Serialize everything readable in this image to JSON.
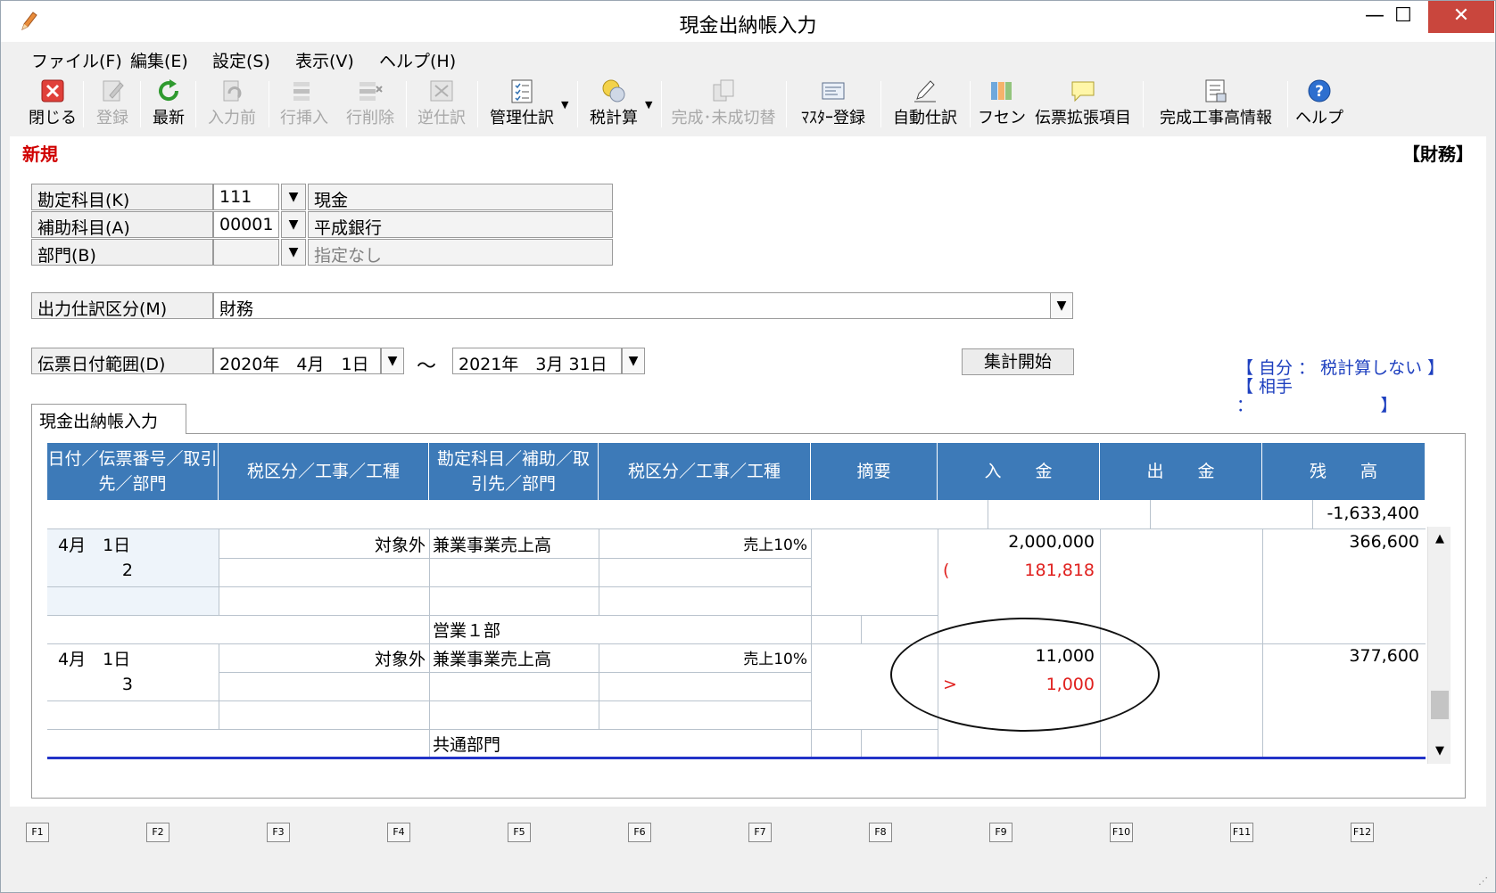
{
  "window": {
    "title": "現金出納帳入力",
    "minimize": "—",
    "maximize": "☐",
    "close": "✕"
  },
  "menu": [
    "ファイル(F)",
    "編集(E)",
    "設定(S)",
    "表示(V)",
    "ヘルプ(H)"
  ],
  "toolbar": {
    "close": "閉じる",
    "register": "登録",
    "refresh": "最新",
    "prev": "入力前",
    "insert_row": "行挿入",
    "delete_row": "行削除",
    "reverse": "逆仕訳",
    "manage": "管理仕訳",
    "tax": "税計算",
    "toggle": "完成･未成切替",
    "master": "ﾏｽﾀｰ登録",
    "auto": "自動仕訳",
    "fusen": "フセン",
    "ext": "伝票拡張項目",
    "completed": "完成工事高情報",
    "help": "ヘルプ"
  },
  "status": {
    "mode": "新規",
    "dept": "【財務】"
  },
  "form": {
    "account": {
      "label": "勘定科目(K)",
      "code": "111",
      "name": "現金"
    },
    "sub": {
      "label": "補助科目(A)",
      "code": "00001",
      "name": "平成銀行"
    },
    "dept": {
      "label": "部門(B)",
      "code": "",
      "name": "指定なし"
    },
    "output": {
      "label": "出力仕訳区分(M)",
      "value": "財務"
    },
    "date": {
      "label": "伝票日付範囲(D)",
      "from": "2020年　4月　1日",
      "sep": "～",
      "to": "2021年　3月 31日"
    },
    "sum_button": "集計開始"
  },
  "taxinfo": {
    "line1": "【 自分 ： 税計算しない 】",
    "line2": "【 相手 ：　　　　　　　　】"
  },
  "tab": "現金出納帳入力",
  "grid": {
    "headers": {
      "c1": "日付／伝票番号／取引先／部門",
      "c2": "税区分／工事／工種",
      "c3": "勘定科目／補助／取引先／部門",
      "c4": "税区分／工事／工種",
      "c5": "摘要",
      "c6": "入　　金",
      "c7": "出　　金",
      "c8": "残　　高"
    },
    "opening_balance": "-1,633,400",
    "rows": [
      {
        "date": "4月　1日",
        "no": "2",
        "tax_self": "対象外",
        "account": "兼業事業売上高",
        "tax_other": "売上10%",
        "in": "2,000,000",
        "tax_mark": "(",
        "tax_amt": "181,818",
        "balance": "366,600",
        "dept": "営業１部"
      },
      {
        "date": "4月　1日",
        "no": "3",
        "tax_self": "対象外",
        "account": "兼業事業売上高",
        "tax_other": "売上10%",
        "in": "11,000",
        "tax_mark": ">",
        "tax_amt": "1,000",
        "balance": "377,600",
        "dept": "共通部門"
      }
    ]
  },
  "fkeys": [
    "F1",
    "F2",
    "F3",
    "F4",
    "F5",
    "F6",
    "F7",
    "F8",
    "F9",
    "F10",
    "F11",
    "F12"
  ],
  "colors": {
    "header": "#3d7ab8",
    "accent_red": "#e0201e",
    "tax_blue": "#1d3fbf"
  }
}
